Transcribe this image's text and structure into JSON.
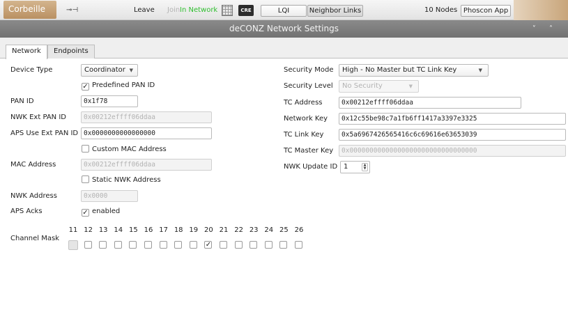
{
  "toolbar": {
    "corbeille": "Corbeille",
    "plug_icon": "plug-icon",
    "leave": "Leave",
    "join": "Join",
    "network_status": "In Network",
    "grid_icon": "network-grid-icon",
    "cre_badge": "CRE",
    "lqi": "LQI",
    "neighbor_links": "Neighbor Links",
    "node_count": "10 Nodes",
    "phoscon_app": "Phoscon App",
    "status_color": "#2fbf2f"
  },
  "title": "deCONZ Network Settings",
  "title_arrows": "˅ ˄",
  "tabs": [
    {
      "label": "Network",
      "active": true
    },
    {
      "label": "Endpoints",
      "active": false
    }
  ],
  "left": {
    "device_type_label": "Device Type",
    "device_type_value": "Coordinator",
    "predefined_pan_label": "Predefined PAN ID",
    "predefined_pan_checked": true,
    "pan_id_label": "PAN ID",
    "pan_id_value": "0x1f78",
    "nwk_ext_pan_label": "NWK Ext PAN ID",
    "nwk_ext_pan_value": "0x00212effff06ddaa",
    "aps_use_ext_pan_label": "APS Use Ext PAN ID",
    "aps_use_ext_pan_value": "0x0000000000000000",
    "custom_mac_label": "Custom MAC Address",
    "custom_mac_checked": false,
    "mac_address_label": "MAC Address",
    "mac_address_value": "0x00212effff06ddaa",
    "static_nwk_label": "Static NWK Address",
    "static_nwk_checked": false,
    "nwk_address_label": "NWK Address",
    "nwk_address_value": "0x0000",
    "aps_acks_label": "APS Acks",
    "aps_acks_option": "enabled",
    "aps_acks_checked": true
  },
  "right": {
    "security_mode_label": "Security Mode",
    "security_mode_value": "High - No Master but TC Link Key",
    "security_level_label": "Security Level",
    "security_level_value": "No Security",
    "tc_address_label": "TC Address",
    "tc_address_value": "0x00212effff06ddaa",
    "network_key_label": "Network Key",
    "network_key_value": "0x12c55be98c7a1fb6ff1417a3397e3325",
    "tc_link_key_label": "TC Link Key",
    "tc_link_key_value": "0x5a6967426565416c6c69616e63653039",
    "tc_master_key_label": "TC Master Key",
    "tc_master_key_value": "0x00000000000000000000000000000000",
    "nwk_update_id_label": "NWK Update ID",
    "nwk_update_id_value": "1"
  },
  "channel_mask": {
    "label": "Channel Mask",
    "channels": [
      {
        "number": "11",
        "checked": false,
        "disabled": true
      },
      {
        "number": "12",
        "checked": false
      },
      {
        "number": "13",
        "checked": false
      },
      {
        "number": "14",
        "checked": false
      },
      {
        "number": "15",
        "checked": false
      },
      {
        "number": "16",
        "checked": false
      },
      {
        "number": "17",
        "checked": false
      },
      {
        "number": "18",
        "checked": false
      },
      {
        "number": "19",
        "checked": false
      },
      {
        "number": "20",
        "checked": true
      },
      {
        "number": "21",
        "checked": false
      },
      {
        "number": "22",
        "checked": false
      },
      {
        "number": "23",
        "checked": false
      },
      {
        "number": "24",
        "checked": false
      },
      {
        "number": "25",
        "checked": false
      },
      {
        "number": "26",
        "checked": false
      }
    ]
  }
}
